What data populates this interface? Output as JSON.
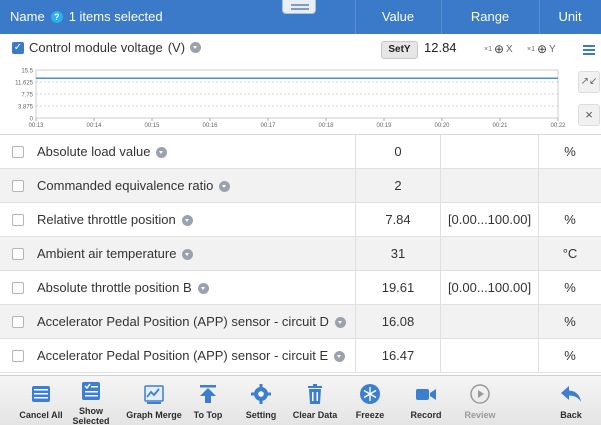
{
  "header": {
    "name_label": "Name",
    "help_icon": "?",
    "selection_text": "1 items selected",
    "value_label": "Value",
    "range_label": "Range",
    "unit_label": "Unit"
  },
  "graph": {
    "title": "Control module voltage",
    "unit": "(V)",
    "sety_label": "SetY",
    "value": "12.84",
    "zoom_x_prefix": "×1",
    "zoom_x_label": "X",
    "zoom_y_prefix": "×1",
    "zoom_y_label": "Y",
    "expand_icon": "↗↙",
    "close_icon": "×"
  },
  "chart_data": {
    "type": "line",
    "title": "",
    "xlabel": "",
    "ylabel": "",
    "y_ticks": [
      "15.5",
      "11.625",
      "7.75",
      "3.875",
      "0"
    ],
    "x_ticks": [
      "00:13",
      "00:14",
      "00:15",
      "00:16",
      "00:17",
      "00:18",
      "00:19",
      "00:20",
      "00:21",
      "00:22"
    ],
    "ylim": [
      0,
      15.5
    ],
    "grid": true,
    "series": [
      {
        "x": [
          "00:13",
          "00:22"
        ],
        "values": [
          12.84,
          12.84
        ],
        "color": "#4a90d9"
      }
    ]
  },
  "rows": [
    {
      "name": "Absolute load value",
      "value": "0",
      "range": "",
      "unit": "%"
    },
    {
      "name": "Commanded equivalence ratio",
      "value": "2",
      "range": "",
      "unit": ""
    },
    {
      "name": "Relative throttle position",
      "value": "7.84",
      "range": "[0.00...100.00]",
      "unit": "%"
    },
    {
      "name": "Ambient air temperature",
      "value": "31",
      "range": "",
      "unit": "°C"
    },
    {
      "name": "Absolute throttle position B",
      "value": "19.61",
      "range": "[0.00...100.00]",
      "unit": "%"
    },
    {
      "name": "Accelerator Pedal Position (APP) sensor - circuit D",
      "value": "16.08",
      "range": "",
      "unit": "%"
    },
    {
      "name": "Accelerator Pedal Position (APP) sensor - circuit E",
      "value": "16.47",
      "range": "",
      "unit": "%"
    }
  ],
  "toolbar": [
    {
      "label": "Cancel All",
      "icon": "cancel-all-icon"
    },
    {
      "label": "Show Selected",
      "icon": "show-selected-icon"
    },
    {
      "label": "Graph Merge",
      "icon": "graph-merge-icon"
    },
    {
      "label": "To Top",
      "icon": "to-top-icon"
    },
    {
      "label": "Setting",
      "icon": "setting-icon"
    },
    {
      "label": "Clear Data",
      "icon": "clear-data-icon"
    },
    {
      "label": "Freeze",
      "icon": "freeze-icon"
    },
    {
      "label": "Record",
      "icon": "record-icon"
    },
    {
      "label": "Review",
      "icon": "review-icon"
    },
    {
      "label": "Back",
      "icon": "back-icon"
    }
  ],
  "colors": {
    "header_bg": "#3b79c9",
    "accent": "#3b79c9",
    "line": "#4a90d9",
    "row_alt": "#f2f2f2"
  }
}
